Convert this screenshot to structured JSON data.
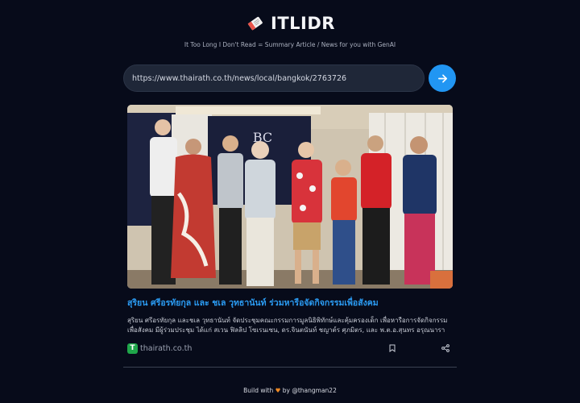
{
  "app": {
    "name": "ITLIDR",
    "tagline": "It Too Long I Don't Read = Summary Article / News for you with GenAI"
  },
  "search": {
    "url_value": "https://www.thairath.co.th/news/local/bangkok/2763726"
  },
  "article": {
    "title": "สุริยน ศรีอรทัยกุล และ ชเล วุทธานันท์ ร่วมหารือจัดกิจกรรมเพื่อสังคม",
    "summary": "สุริยน ศรีอรทัยกุล และชเล วุทธานันท์ จัดประชุมคณะกรรมการมูลนิธิพิทักษ์และคุ้มครองเด็ก เพื่อหารือการจัดกิจกรรมเพื่อสังคม มีผู้ร่วมประชุม ได้แก่ สเวน ฟิลลิป โซเรนเซน, ดร.จินตนันท์ ชญาต์ร ศุภมิตร, และ พ.ต.อ.สุนทร อรุณนารา",
    "source_letter": "T",
    "source": "thairath.co.th",
    "image_sign_letters": "BC"
  },
  "footer": {
    "prefix": "Build with",
    "heart": "♥",
    "suffix": "by @thangman22"
  },
  "colors": {
    "background": "#070b1a",
    "accent": "#2196f3",
    "title": "#2b9bf2",
    "source_brand": "#1fa64a"
  },
  "icons": [
    "logo-icon",
    "arrow-right-icon",
    "bookmark-icon",
    "share-icon"
  ]
}
